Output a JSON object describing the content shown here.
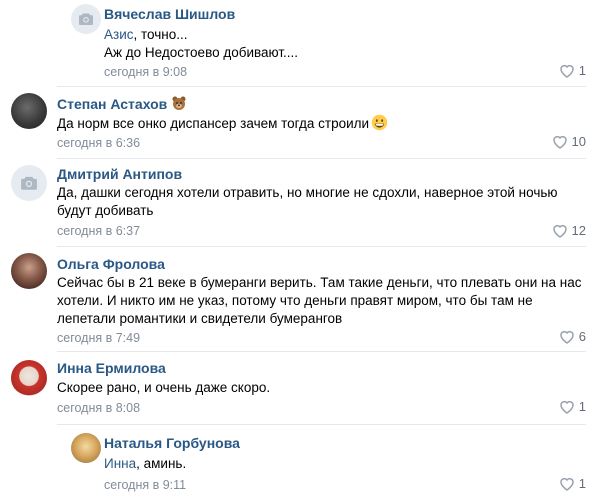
{
  "comments": [
    {
      "author": "Вячеслав Шишлов",
      "avatar": "camera-placeholder-icon",
      "mention": "Азис",
      "text_after_mention": ", точно...",
      "text_line2": "Аж до Недостоево добивают....",
      "time": "сегодня в 9:08",
      "likes": "1"
    },
    {
      "author": "Степан Астахов",
      "badge": "bear-emoji-icon",
      "avatar": "user-photo",
      "text": "Да норм все онко диспансер зачем тогда строили",
      "emoji": "grinning-face-icon",
      "time": "сегодня в 6:36",
      "likes": "10"
    },
    {
      "author": "Дмитрий Антипов",
      "avatar": "camera-placeholder-icon",
      "text_lines": [
        "Да, дашки сегодня хотели отравить, но многие не сдохли, наверное этой ночью",
        "будут добивать"
      ],
      "time": "сегодня в 6:37",
      "likes": "12"
    },
    {
      "author": "Ольга Фролова",
      "avatar": "user-photo",
      "text_lines": [
        "Сейчас бы в 21 веке в бумеранги верить. Там такие деньги, что плевать они на нас",
        "хотели. И никто им не указ, потому что деньги правят миром, что бы там не",
        "лепетали романтики и свидетели бумерангов"
      ],
      "time": "сегодня в 7:49",
      "likes": "6"
    },
    {
      "author": "Инна Ермилова",
      "avatar": "user-photo",
      "text": "Скорее рано, и очень даже скоро.",
      "time": "сегодня в 8:08",
      "likes": "1"
    },
    {
      "author": "Наталья Горбунова",
      "avatar": "user-photo",
      "mention": "Инна",
      "text_after_mention": ", аминь.",
      "time": "сегодня в 9:11",
      "likes": "1"
    }
  ],
  "colors": {
    "link": "#2a5885",
    "meta": "#818c99",
    "divider": "#e7e8ec",
    "like_icon": "#99a2ad"
  }
}
